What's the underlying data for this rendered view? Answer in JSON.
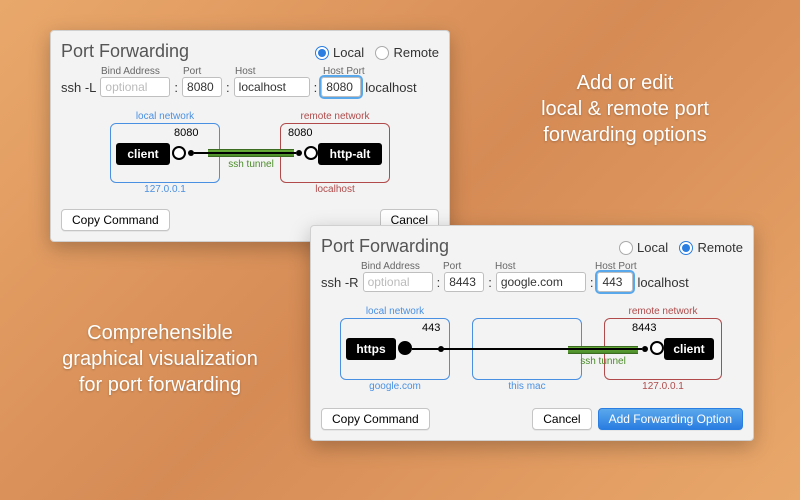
{
  "captions": {
    "top_right": "Add or edit\nlocal & remote port\nforwarding options",
    "bottom_left": "Comprehensible\ngraphical visualization\nfor port forwarding"
  },
  "panel1": {
    "title": "Port Forwarding",
    "radio_local": "Local",
    "radio_remote": "Remote",
    "radio_selected": "Local",
    "labels": {
      "bind": "Bind Address",
      "port": "Port",
      "host": "Host",
      "host_port": "Host Port"
    },
    "prefix": "ssh -L",
    "bind_placeholder": "optional",
    "port": "8080",
    "host": "localhost",
    "host_port": "8080",
    "suffix": "localhost",
    "diagram": {
      "local_label": "local network",
      "remote_label": "remote network",
      "local_ip": "127.0.0.1",
      "remote_host": "localhost",
      "tunnel_label": "ssh tunnel",
      "left_node": "client",
      "right_node": "http-alt",
      "left_port": "8080",
      "right_port": "8080"
    },
    "btn_copy": "Copy Command",
    "btn_cancel": "Cancel"
  },
  "panel2": {
    "title": "Port Forwarding",
    "radio_local": "Local",
    "radio_remote": "Remote",
    "radio_selected": "Remote",
    "labels": {
      "bind": "Bind Address",
      "port": "Port",
      "host": "Host",
      "host_port": "Host Port"
    },
    "prefix": "ssh -R",
    "bind_placeholder": "optional",
    "port": "8443",
    "host": "google.com",
    "host_port": "443",
    "suffix": "localhost",
    "diagram": {
      "local_label": "local network",
      "mid_label": "this mac",
      "remote_label": "remote network",
      "local_host": "google.com",
      "remote_ip": "127.0.0.1",
      "tunnel_label": "ssh tunnel",
      "left_node": "https",
      "right_node": "client",
      "left_port": "443",
      "right_port": "8443"
    },
    "btn_copy": "Copy Command",
    "btn_cancel": "Cancel",
    "btn_add": "Add Forwarding Option"
  }
}
